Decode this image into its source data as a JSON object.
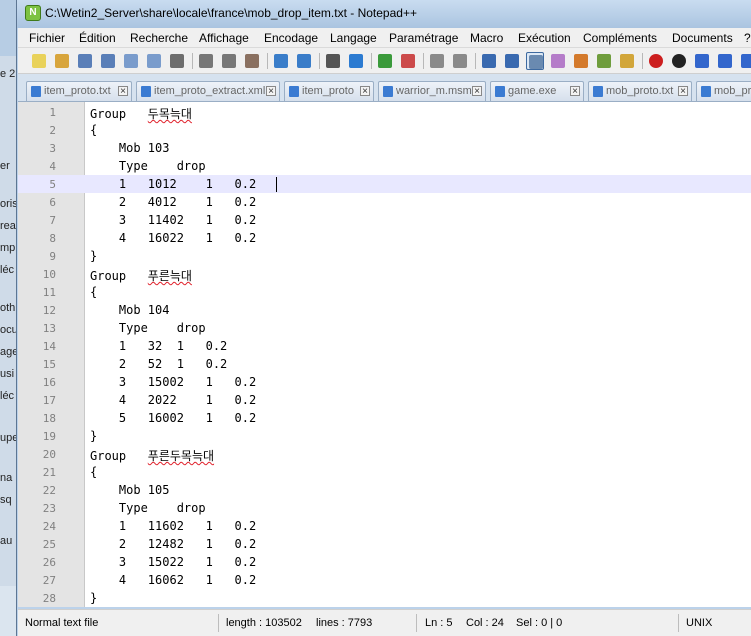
{
  "window": {
    "title": "C:\\Wetin2_Server\\share\\locale\\france\\mob_drop_item.txt - Notepad++"
  },
  "background_app": {
    "fragments": [
      "e 2",
      "er",
      "oris",
      "rea",
      "mpl",
      "léc",
      "oth",
      "ocu",
      "age",
      "usi",
      "léc",
      "upe",
      "na",
      "sq",
      "au"
    ]
  },
  "menu": [
    "Fichier",
    "Édition",
    "Recherche",
    "Affichage",
    "Encodage",
    "Langage",
    "Paramétrage",
    "Macro",
    "Exécution",
    "Compléments",
    "Documents",
    "?"
  ],
  "toolbar": {
    "icons": [
      "new-file-icon",
      "open-file-icon",
      "save-icon",
      "save-all-icon",
      "close-icon",
      "close-all-icon",
      "print-icon",
      "cut-icon",
      "copy-icon",
      "paste-icon",
      "undo-icon",
      "redo-icon",
      "find-icon",
      "replace-icon",
      "zoom-in-icon",
      "zoom-out-icon",
      "sync-vertical-icon",
      "sync-horizontal-icon",
      "word-wrap-icon",
      "show-all-chars-icon",
      "indent-guide-icon",
      "user-lang-icon",
      "doc-map-icon",
      "function-list-icon",
      "folder-workspace-icon",
      "record-macro-icon",
      "stop-macro-icon",
      "play-macro-icon",
      "run-macro-multiple-icon",
      "save-macro-icon"
    ]
  },
  "tabs": [
    {
      "label": "item_proto.txt"
    },
    {
      "label": "item_proto_extract.xml"
    },
    {
      "label": "item_proto"
    },
    {
      "label": "warrior_m.msm"
    },
    {
      "label": "game.exe"
    },
    {
      "label": "mob_proto.txt"
    },
    {
      "label": "mob_proto.txt"
    }
  ],
  "editor": {
    "current_line": 5,
    "lines": [
      {
        "n": "1",
        "text": "Group   ",
        "ko": "두목늑대"
      },
      {
        "n": "2",
        "text": "{"
      },
      {
        "n": "3",
        "text": "    Mob 103"
      },
      {
        "n": "4",
        "text": "    Type    drop"
      },
      {
        "n": "5",
        "text": "    1   1012    1   0.2"
      },
      {
        "n": "6",
        "text": "    2   4012    1   0.2"
      },
      {
        "n": "7",
        "text": "    3   11402   1   0.2"
      },
      {
        "n": "8",
        "text": "    4   16022   1   0.2"
      },
      {
        "n": "9",
        "text": "}"
      },
      {
        "n": "10",
        "text": "Group   ",
        "ko": "푸른늑대"
      },
      {
        "n": "11",
        "text": "{"
      },
      {
        "n": "12",
        "text": "    Mob 104"
      },
      {
        "n": "13",
        "text": "    Type    drop"
      },
      {
        "n": "14",
        "text": "    1   32  1   0.2"
      },
      {
        "n": "15",
        "text": "    2   52  1   0.2"
      },
      {
        "n": "16",
        "text": "    3   15002   1   0.2"
      },
      {
        "n": "17",
        "text": "    4   2022    1   0.2"
      },
      {
        "n": "18",
        "text": "    5   16002   1   0.2"
      },
      {
        "n": "19",
        "text": "}"
      },
      {
        "n": "20",
        "text": "Group   ",
        "ko": "푸른두목늑대"
      },
      {
        "n": "21",
        "text": "{"
      },
      {
        "n": "22",
        "text": "    Mob 105"
      },
      {
        "n": "23",
        "text": "    Type    drop"
      },
      {
        "n": "24",
        "text": "    1   11602   1   0.2"
      },
      {
        "n": "25",
        "text": "    2   12482   1   0.2"
      },
      {
        "n": "26",
        "text": "    3   15022   1   0.2"
      },
      {
        "n": "27",
        "text": "    4   16062   1   0.2"
      },
      {
        "n": "28",
        "text": "}"
      }
    ]
  },
  "status": {
    "file_type": "Normal text file",
    "length": "length : 103502",
    "lines": "lines : 7793",
    "ln": "Ln : 5",
    "col": "Col : 24",
    "sel": "Sel : 0 | 0",
    "eol": "UNIX"
  },
  "colors": {
    "current_line": "#e8e8ff",
    "gutter": "#e4e4e4",
    "titlebar": "#bcd2ea"
  }
}
